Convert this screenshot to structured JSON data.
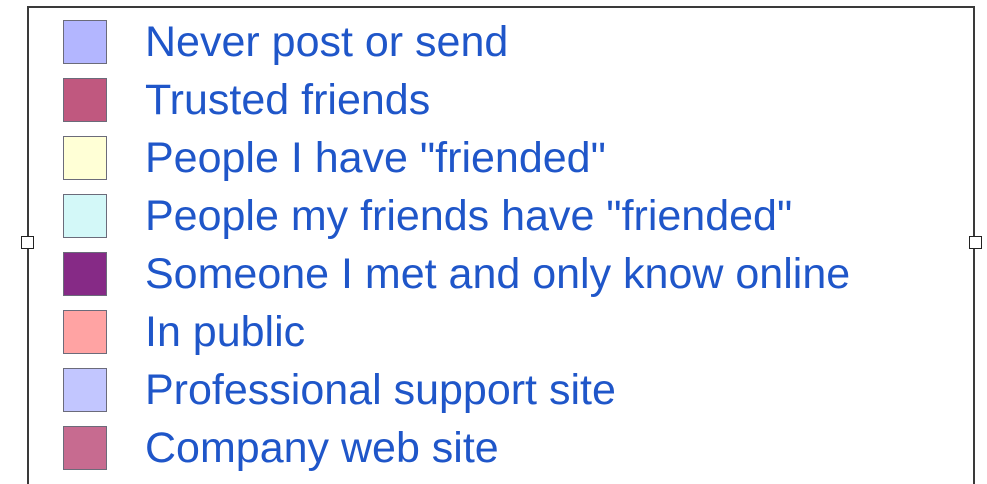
{
  "chart_data": {
    "type": "legend",
    "title": "",
    "entries": [
      {
        "label": "Never post or send",
        "color": "#b3b6ff"
      },
      {
        "label": "Trusted friends",
        "color": "#c0587f"
      },
      {
        "label": "People I have \"friended\"",
        "color": "#ffffd6"
      },
      {
        "label": "People my friends have \"friended\"",
        "color": "#d3f8f8"
      },
      {
        "label": "Someone I met and only know online",
        "color": "#862a86"
      },
      {
        "label": "In public",
        "color": "#ffa3a3"
      },
      {
        "label": "Professional support site",
        "color": "#c2c6ff"
      },
      {
        "label": "Company web site",
        "color": "#c76b90"
      }
    ]
  },
  "text_color": "#1f56c9",
  "selection_handles": [
    "left",
    "right"
  ]
}
